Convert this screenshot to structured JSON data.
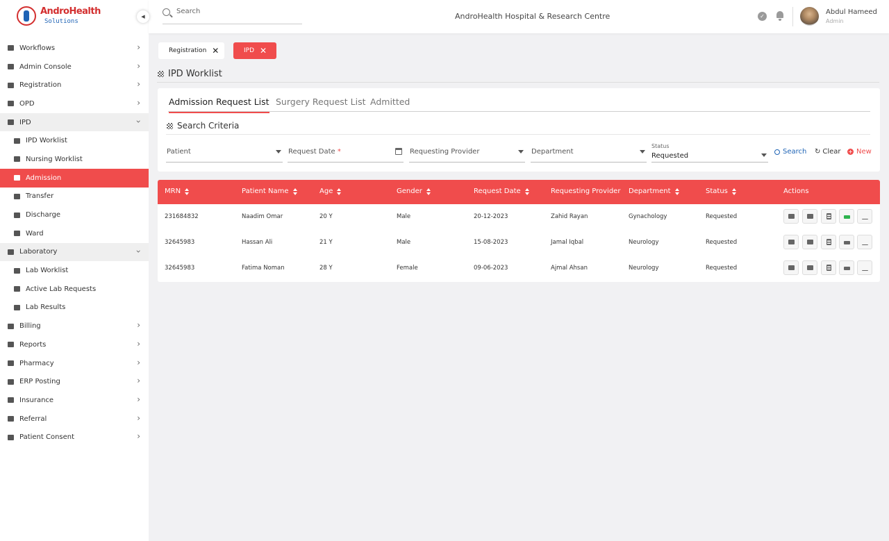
{
  "brand": {
    "name": "AndroHealth",
    "tagline": "Solutions"
  },
  "header": {
    "search_placeholder": "Search",
    "hospital_name": "AndroHealth Hospital & Research Centre",
    "user_name": "Abdul Hameed",
    "user_role": "Admin"
  },
  "sidebar": {
    "items": [
      {
        "label": "Workflows",
        "icon": "monitor-icon"
      },
      {
        "label": "Admin Console",
        "icon": "gear-icon"
      },
      {
        "label": "Registration",
        "icon": "clipboard-check-icon"
      },
      {
        "label": "OPD",
        "icon": "building-icon"
      },
      {
        "label": "IPD",
        "icon": "bed-icon"
      },
      {
        "label": "IPD Worklist",
        "icon": "clipboard-list-icon"
      },
      {
        "label": "Nursing Worklist",
        "icon": "nurse-icon"
      },
      {
        "label": "Admission",
        "icon": "admission-icon"
      },
      {
        "label": "Transfer",
        "icon": "transfer-icon"
      },
      {
        "label": "Discharge",
        "icon": "wheelchair-icon"
      },
      {
        "label": "Ward",
        "icon": "ward-icon"
      },
      {
        "label": "Laboratory",
        "icon": "flask-icon"
      },
      {
        "label": "Lab Worklist",
        "icon": "test-tube-icon"
      },
      {
        "label": "Active Lab Requests",
        "icon": "test-tube-icon"
      },
      {
        "label": "Lab Results",
        "icon": "lab-result-icon"
      },
      {
        "label": "Billing",
        "icon": "credit-card-icon"
      },
      {
        "label": "Reports",
        "icon": "report-icon"
      },
      {
        "label": "Pharmacy",
        "icon": "pharmacy-icon"
      },
      {
        "label": "ERP Posting",
        "icon": "desktop-icon"
      },
      {
        "label": "Insurance",
        "icon": "family-icon"
      },
      {
        "label": "Referral",
        "icon": "users-icon"
      },
      {
        "label": "Patient Consent",
        "icon": "signature-icon"
      }
    ]
  },
  "page_tabs": [
    "Registration",
    "IPD"
  ],
  "page_title": "IPD Worklist",
  "content_tabs": [
    "Admission Request List",
    "Surgery Request List",
    "Admitted"
  ],
  "search_criteria": {
    "title": "Search Criteria",
    "patient": "Patient",
    "request_date": "Request Date",
    "required_mark": "*",
    "requesting_provider": "Requesting Provider",
    "department": "Department",
    "status_label": "Status",
    "status_value": "Requested",
    "search": "Search",
    "clear": "Clear",
    "new": "New"
  },
  "table": {
    "headers": [
      "MRN",
      "Patient Name",
      "Age",
      "Gender",
      "Request Date",
      "Requesting Provider",
      "Department",
      "Status",
      "Actions"
    ],
    "rows": [
      [
        "231684832",
        "Naadim Omar",
        "20 Y",
        "Male",
        "20-12-2023",
        "Zahid Rayan",
        "Gynachology",
        "Requested"
      ],
      [
        "32645983",
        "Hassan Ali",
        "21 Y",
        "Male",
        "15-08-2023",
        "Jamal Iqbal",
        "Neurology",
        "Requested"
      ],
      [
        "32645983",
        "Fatima Noman",
        "28 Y",
        "Female",
        "09-06-2023",
        "Ajmal Ahsan",
        "Neurology",
        "Requested"
      ]
    ],
    "action_icons": [
      "admission-icon",
      "ward-icon",
      "notes-icon",
      "bed-icon",
      "signature-icon"
    ],
    "bed_active_color": "#2fb34f"
  },
  "colors": {
    "accent": "#f04c4c",
    "link": "#1e63b5"
  }
}
